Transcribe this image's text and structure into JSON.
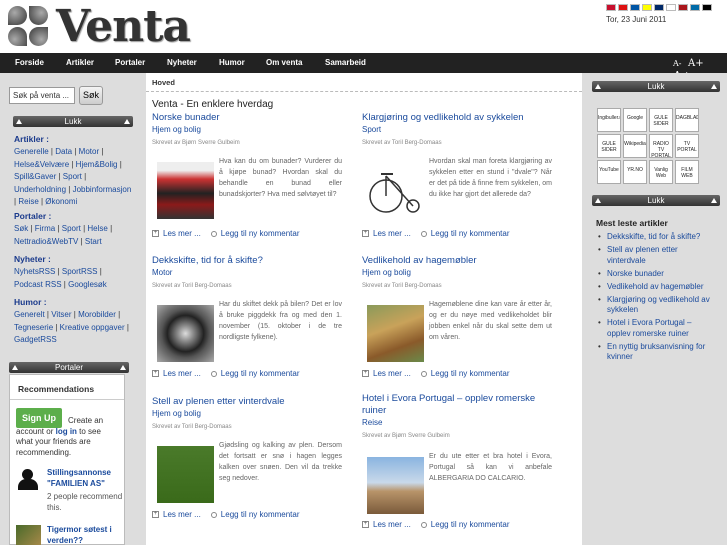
{
  "brand": {
    "logo_text": "Venta"
  },
  "header": {
    "date": "Tor, 23 Juni 2011",
    "flags": [
      "#c8102e",
      "#d11",
      "#0055a4",
      "#ff0",
      "#002868",
      "#fff",
      "#aa151b",
      "#006aa7",
      "#000"
    ]
  },
  "nav": {
    "items": [
      "Forside",
      "Artikler",
      "Portaler",
      "Nyheter",
      "Humor",
      "Om venta",
      "Samarbeid"
    ],
    "font_sizes": [
      "A-",
      "A+",
      "A+"
    ]
  },
  "search": {
    "value": "Søk på venta ...",
    "button": "Søk"
  },
  "left_panel": {
    "close_label": "Lukk",
    "artikler": {
      "heading": "Artikler :",
      "links": [
        "Generelle",
        "Data",
        "Motor",
        "Helse&Velvære",
        "Hjem&Bolig",
        "Spill&Gaver",
        "Sport",
        "Underholdning",
        "Jobbinformasjon",
        "Reise",
        "Økonomi"
      ]
    },
    "portaler": {
      "heading": "Portaler :",
      "links": [
        "Søk",
        "Firma",
        "Sport",
        "Helse",
        "Nettradio&WebTV",
        "Start"
      ]
    },
    "nyheter": {
      "heading": "Nyheter :",
      "links": [
        "NyhetsRSS",
        "SportRSS",
        "Podcast RSS",
        "Googlesøk"
      ]
    },
    "humor": {
      "heading": "Humor :",
      "links": [
        "Generelt",
        "Vitser",
        "Morobilder",
        "Tegneserie",
        "Kreative oppgaver",
        "GadgetRSS"
      ]
    }
  },
  "portaler_panel": {
    "title": "Portaler",
    "recommendations_title": "Recommendations",
    "signup_button": "Sign Up",
    "signup_text_1": "Create an account or",
    "signup_login": "log in",
    "signup_text_2": "to see what your friends are recommending.",
    "items": [
      {
        "title": "Stillingsannonse \"FAMILIEN AS\"",
        "sub": "2 people recommend this."
      },
      {
        "title": "Tigermor søtest i verden??",
        "sub": ""
      }
    ]
  },
  "main": {
    "breadcrumb": "Hoved",
    "title": "Venta - En enklere hverdag",
    "more_label": "Les mer ...",
    "comment_label": "Legg til ny kommentar",
    "articles": [
      {
        "title": "Norske bunader",
        "category": "Hjem og bolig",
        "author": "Skrevet av Bjørn Sverre Gulbeim",
        "text": "Hva kan du om bunader? Vurderer du å kjøpe bunad? Hvordan skal du behandle en bunad eller bunadskjorter? Hva med sølvtøyet til?"
      },
      {
        "title": "Klargjøring og vedlikehold av sykkelen",
        "category": "Sport",
        "author": "Skrevet av Toril Berg-Domaas",
        "text": "Hvordan skal man foreta klargjøring av sykkelen etter en stund i \"dvale\"? Når er det på tide å finne frem sykkelen, om du ikke har gjort det allerede da?"
      },
      {
        "title": "Dekkskifte, tid for å skifte?",
        "category": "Motor",
        "author": "Skrevet av Toril Berg-Domaas",
        "text": "Har du skiftet dekk på bilen? Det er lov å bruke piggdekk fra og med den 1. november (15. oktober i de tre nordligste fylkene)."
      },
      {
        "title": "Vedlikehold av hagemøbler",
        "category": "Hjem og bolig",
        "author": "Skrevet av Toril Berg-Domaas",
        "text": "Hagemøblene dine kan vare år etter år, og er du nøye med vedlikeholdet blir jobben enkel når du skal sette dem ut om våren."
      },
      {
        "title": "Stell av plenen etter vinterdvale",
        "category": "Hjem og bolig",
        "author": "Skrevet av Toril Berg-Domaas",
        "text": "Gjødsling og kalking av plen. Dersom det fortsatt er snø i hagen legges kalken over snøen. Den vil da trekke seg nedover."
      },
      {
        "title": "Hotel i Evora Portugal – opplev romerske ruiner",
        "category": "Reise",
        "author": "Skrevet av Bjørn Sverre Gulbeim",
        "text": "Er du ute etter et bra hotel i Evora, Portugal så kan vi anbefale ALBERGARIA DO CALCARIO."
      }
    ]
  },
  "right_panel": {
    "close_label": "Lukk",
    "ads": [
      "Ingibuller.no",
      "Google",
      "GULE SIDER",
      "DAGBLADET",
      "GULE SIDER",
      "Wikipedia",
      "RADIO TV PORTAL",
      "TV PORTAL",
      "YouTube",
      "YR.NO",
      "Vanlig Web",
      "FILM WEB"
    ],
    "most_read_title": "Mest leste artikler",
    "most_read": [
      "Dekkskifte, tid for å skifte?",
      "Stell av plenen etter vinterdvale",
      "Norske bunader",
      "Vedlikehold av hagemøbler",
      "Klargjøring og vedlikehold av sykkelen",
      "Hotel i Evora Portugal – opplev romerske ruiner",
      "En nyttig bruksanvisning for kvinner"
    ]
  }
}
